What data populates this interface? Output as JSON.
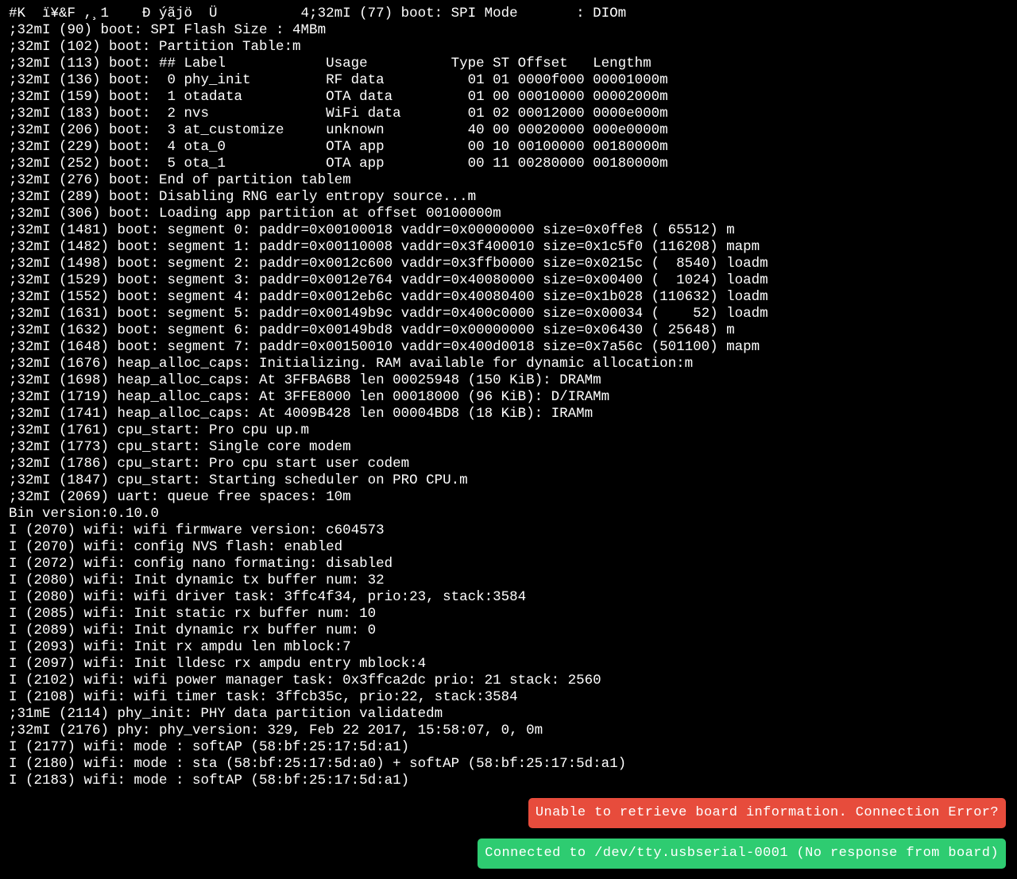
{
  "terminal": {
    "lines": [
      "#K  ï¥&F ,¸1    Ð ýãjö  Ü          4;32mI (77) boot: SPI Mode       : DIOm",
      ";32mI (90) boot: SPI Flash Size : 4MBm",
      ";32mI (102) boot: Partition Table:m",
      ";32mI (113) boot: ## Label            Usage          Type ST Offset   Lengthm",
      ";32mI (136) boot:  0 phy_init         RF data          01 01 0000f000 00001000m",
      ";32mI (159) boot:  1 otadata          OTA data         01 00 00010000 00002000m",
      ";32mI (183) boot:  2 nvs              WiFi data        01 02 00012000 0000e000m",
      ";32mI (206) boot:  3 at_customize     unknown          40 00 00020000 000e0000m",
      ";32mI (229) boot:  4 ota_0            OTA app          00 10 00100000 00180000m",
      ";32mI (252) boot:  5 ota_1            OTA app          00 11 00280000 00180000m",
      ";32mI (276) boot: End of partition tablem",
      ";32mI (289) boot: Disabling RNG early entropy source...m",
      ";32mI (306) boot: Loading app partition at offset 00100000m",
      ";32mI (1481) boot: segment 0: paddr=0x00100018 vaddr=0x00000000 size=0x0ffe8 ( 65512) m",
      ";32mI (1482) boot: segment 1: paddr=0x00110008 vaddr=0x3f400010 size=0x1c5f0 (116208) mapm",
      ";32mI (1498) boot: segment 2: paddr=0x0012c600 vaddr=0x3ffb0000 size=0x0215c (  8540) loadm",
      ";32mI (1529) boot: segment 3: paddr=0x0012e764 vaddr=0x40080000 size=0x00400 (  1024) loadm",
      ";32mI (1552) boot: segment 4: paddr=0x0012eb6c vaddr=0x40080400 size=0x1b028 (110632) loadm",
      ";32mI (1631) boot: segment 5: paddr=0x00149b9c vaddr=0x400c0000 size=0x00034 (    52) loadm",
      ";32mI (1632) boot: segment 6: paddr=0x00149bd8 vaddr=0x00000000 size=0x06430 ( 25648) m",
      ";32mI (1648) boot: segment 7: paddr=0x00150010 vaddr=0x400d0018 size=0x7a56c (501100) mapm",
      ";32mI (1676) heap_alloc_caps: Initializing. RAM available for dynamic allocation:m",
      ";32mI (1698) heap_alloc_caps: At 3FFBA6B8 len 00025948 (150 KiB): DRAMm",
      ";32mI (1719) heap_alloc_caps: At 3FFE8000 len 00018000 (96 KiB): D/IRAMm",
      ";32mI (1741) heap_alloc_caps: At 4009B428 len 00004BD8 (18 KiB): IRAMm",
      ";32mI (1761) cpu_start: Pro cpu up.m",
      ";32mI (1773) cpu_start: Single core modem",
      ";32mI (1786) cpu_start: Pro cpu start user codem",
      ";32mI (1847) cpu_start: Starting scheduler on PRO CPU.m",
      ";32mI (2069) uart: queue free spaces: 10m",
      "Bin version:0.10.0",
      "I (2070) wifi: wifi firmware version: c604573",
      "I (2070) wifi: config NVS flash: enabled",
      "I (2072) wifi: config nano formating: disabled",
      "I (2080) wifi: Init dynamic tx buffer num: 32",
      "I (2080) wifi: wifi driver task: 3ffc4f34, prio:23, stack:3584",
      "I (2085) wifi: Init static rx buffer num: 10",
      "I (2089) wifi: Init dynamic rx buffer num: 0",
      "I (2093) wifi: Init rx ampdu len mblock:7",
      "I (2097) wifi: Init lldesc rx ampdu entry mblock:4",
      "I (2102) wifi: wifi power manager task: 0x3ffca2dc prio: 21 stack: 2560",
      "I (2108) wifi: wifi timer task: 3ffcb35c, prio:22, stack:3584",
      ";31mE (2114) phy_init: PHY data partition validatedm",
      ";32mI (2176) phy: phy_version: 329, Feb 22 2017, 15:58:07, 0, 0m",
      "I (2177) wifi: mode : softAP (58:bf:25:17:5d:a1)",
      "I (2180) wifi: mode : sta (58:bf:25:17:5d:a0) + softAP (58:bf:25:17:5d:a1)",
      "I (2183) wifi: mode : softAP (58:bf:25:17:5d:a1)"
    ]
  },
  "notifications": {
    "error": {
      "text": "Unable to retrieve board information. Connection Error?",
      "color": "#e74c3c"
    },
    "success": {
      "text": "Connected to /dev/tty.usbserial-0001 (No response from board)",
      "color": "#2ecc71"
    }
  },
  "colors": {
    "background": "#000000",
    "text": "#ffffff"
  }
}
